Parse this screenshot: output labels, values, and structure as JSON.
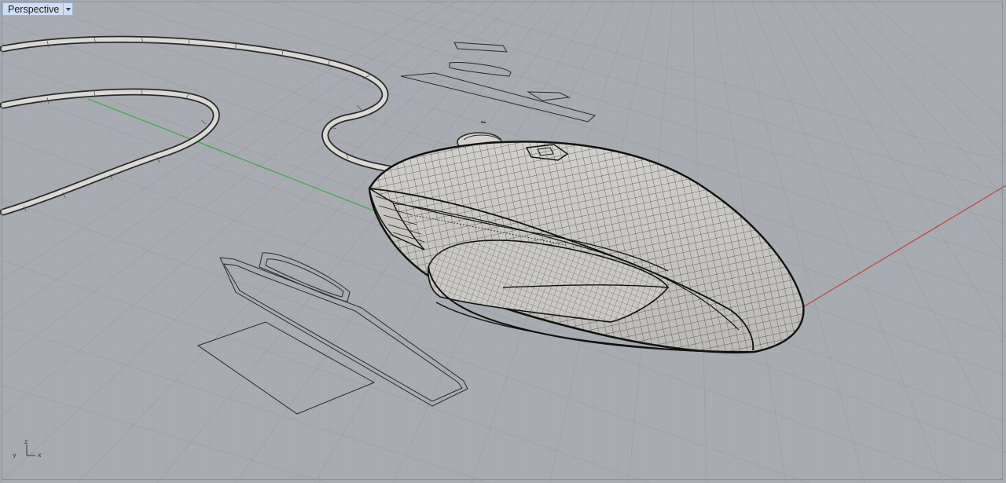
{
  "viewport": {
    "title": "Perspective",
    "mode": "wireframe",
    "background_color": "#a8abb1",
    "grid_color": "#9b9fa5",
    "x_axis_color": "#c43a3a",
    "y_axis_color": "#3aa843"
  },
  "axis_gizmo": {
    "x": "x",
    "y": "y",
    "z": "z"
  },
  "model": {
    "object": "computer-mouse",
    "cable": "mouse-cable"
  }
}
